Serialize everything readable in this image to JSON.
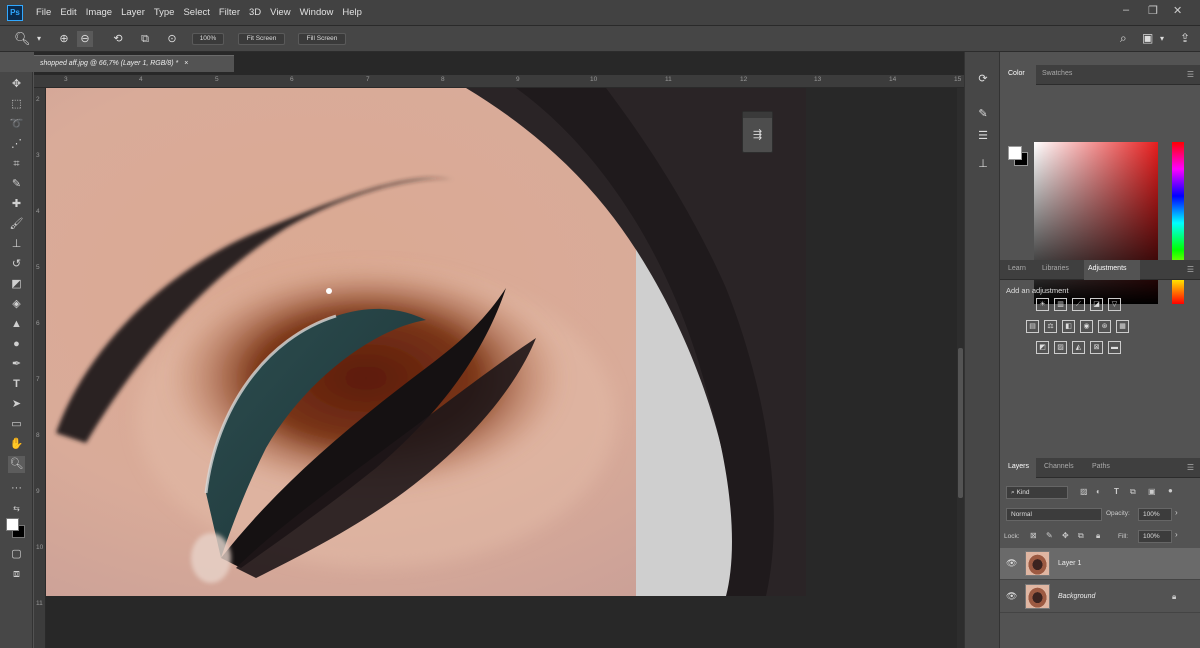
{
  "app": {
    "logo": "Ps"
  },
  "menu": [
    "File",
    "Edit",
    "Image",
    "Layer",
    "Type",
    "Select",
    "Filter",
    "3D",
    "View",
    "Window",
    "Help"
  ],
  "window_controls": {
    "minimize": "–",
    "restore": "❐",
    "close": "✕"
  },
  "options_bar": {
    "zoom_level_label": "100%",
    "fit_screen_label": "Fit Screen",
    "fill_screen_label": "Fill Screen"
  },
  "document": {
    "tab_title": "shopped aff.jpg @ 66,7% (Layer 1, RGB/8) *",
    "tab_close": "×",
    "ruler_h": [
      "3",
      "4",
      "5",
      "6",
      "7",
      "8",
      "9",
      "10",
      "11",
      "12",
      "13",
      "14",
      "15"
    ],
    "ruler_v": [
      "2",
      "3",
      "4",
      "5",
      "6",
      "7",
      "8",
      "9",
      "10",
      "11"
    ]
  },
  "color_panel": {
    "tabs": [
      "Color",
      "Swatches"
    ],
    "active": "Color"
  },
  "adjustments_panel": {
    "tabs": [
      "Learn",
      "Libraries",
      "Adjustments"
    ],
    "active": "Adjustments",
    "heading": "Add an adjustment"
  },
  "layers_panel": {
    "tabs": [
      "Layers",
      "Channels",
      "Paths"
    ],
    "active": "Layers",
    "filter_label": "Kind",
    "blend_mode": "Normal",
    "opacity_label": "Opacity:",
    "opacity_value": "100%",
    "lock_label": "Lock:",
    "fill_label": "Fill:",
    "fill_value": "100%",
    "layers": [
      {
        "name": "Layer 1",
        "selected": true
      },
      {
        "name": "Background",
        "locked": true
      }
    ]
  }
}
